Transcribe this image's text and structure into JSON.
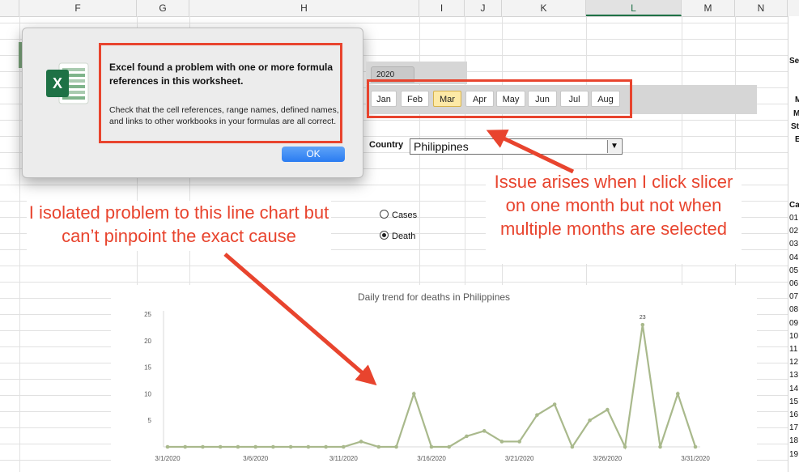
{
  "columns": [
    "F",
    "G",
    "H",
    "I",
    "J",
    "K",
    "L",
    "M",
    "N"
  ],
  "active_column": "L",
  "right_column": {
    "header_letters": [
      "Se",
      "M",
      "M",
      "St",
      "E"
    ],
    "table_header": "Ca",
    "row_numbers": [
      "01",
      "02",
      "03",
      "04",
      "05",
      "06",
      "07",
      "08",
      "09",
      "10",
      "11",
      "12",
      "13",
      "14",
      "15",
      "16",
      "17",
      "18",
      "19"
    ]
  },
  "dialog": {
    "title": "Excel found a problem with one or more formula references in this worksheet.",
    "body": "Check that the cell references, range names, defined names, and links to other workbooks in your formulas are all correct.",
    "ok_label": "OK"
  },
  "slicer": {
    "tab_label": "2020",
    "months": [
      "Jan",
      "Feb",
      "Mar",
      "Apr",
      "May",
      "Jun",
      "Jul",
      "Aug"
    ],
    "selected": "Mar"
  },
  "country": {
    "label": "Country",
    "value": "Philippines"
  },
  "radio": {
    "options": [
      "Cases",
      "Death"
    ],
    "selected": "Death"
  },
  "callouts": {
    "chart_note": "I isolated problem to this line chart but can’t pinpoint the exact cause",
    "slicer_note": "Issue arises when I click slicer on one month but not when multiple months are selected"
  },
  "colors": {
    "accent_red": "#e8442e",
    "line": "#a9b98c",
    "excel_green": "#1e7145"
  },
  "chart_data": {
    "type": "line",
    "title": "Daily trend for deaths in Philippines",
    "xlabel": "",
    "ylabel": "",
    "ylim": [
      0,
      25
    ],
    "yticks": [
      5,
      10,
      15,
      20,
      25
    ],
    "x_tick_labels": [
      "3/1/2020",
      "3/6/2020",
      "3/11/2020",
      "3/16/2020",
      "3/21/2020",
      "3/26/2020",
      "3/31/2020"
    ],
    "x_tick_index": [
      0,
      5,
      10,
      15,
      20,
      25,
      30
    ],
    "days": [
      1,
      2,
      3,
      4,
      5,
      6,
      7,
      8,
      9,
      10,
      11,
      12,
      13,
      14,
      15,
      16,
      17,
      18,
      19,
      20,
      21,
      22,
      23,
      24,
      25,
      26,
      27,
      28,
      29,
      30,
      31
    ],
    "values": [
      0,
      0,
      0,
      0,
      0,
      0,
      0,
      0,
      0,
      0,
      0,
      1,
      0,
      0,
      10,
      0,
      0,
      2,
      3,
      1,
      1,
      6,
      8,
      0,
      5,
      7,
      0,
      23,
      0,
      10,
      0
    ],
    "data_label": {
      "index": 27,
      "text": "23"
    }
  }
}
